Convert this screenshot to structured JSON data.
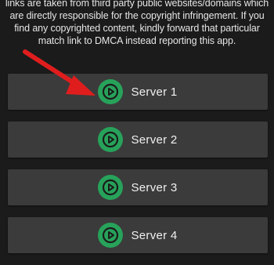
{
  "disclaimer": {
    "lines": [
      "links are taken from third party public websites/domains which",
      "are directly responsible for the copyright infringement. If you",
      "find any copyrighted content, kindly forward that particular",
      "match link to DMCA instead reporting this app."
    ]
  },
  "servers": [
    {
      "label": "Server 1"
    },
    {
      "label": "Server 2"
    },
    {
      "label": "Server 3"
    },
    {
      "label": "Server 4"
    }
  ],
  "colors": {
    "background": "#1b1b1b",
    "button": "#3b3b3b",
    "play_icon": "#27a25a",
    "arrow": "#e01d1d"
  },
  "icons": {
    "server_button_icon": "play-circle-icon",
    "annotation": "red-arrow"
  }
}
